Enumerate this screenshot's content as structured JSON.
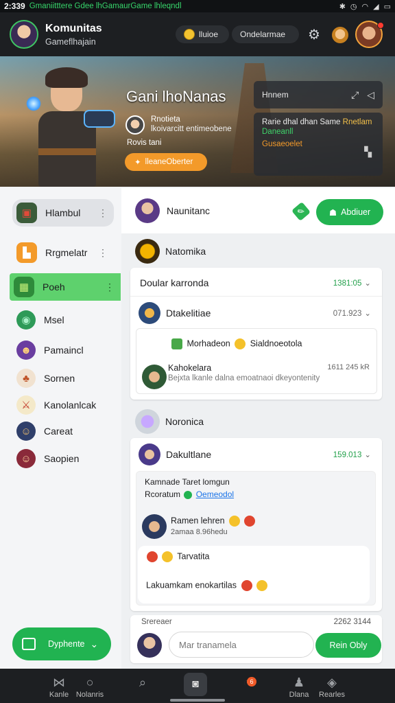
{
  "status_bar": {
    "time": "2:339",
    "ticker": "Gmaniitttere Gdee lhGamaurGame lhleqndl",
    "icons": [
      "bluetooth-icon",
      "alarm-icon",
      "wifi-icon",
      "signal-icon",
      "battery-icon"
    ]
  },
  "header": {
    "title": "Komunitas",
    "subtitle": "Gameflhajain",
    "coins_label": "lluioe",
    "secondary_label": "Ondelarmae"
  },
  "banner": {
    "title": "Gani lhoNanas",
    "author_name": "Rnotieta",
    "author_desc": "lkoivarcitt entimeobene",
    "author_sub": "Rovis tani",
    "cta_label": "lleaneOberter",
    "card1_label": "Hnnem",
    "card2_line1": "Rarie dhal dhan Same",
    "card2_line1_accent": "Rnetlam",
    "card2_line2": "Daneanll",
    "card2_line3": "Gusaeoelet"
  },
  "sidebar": {
    "items": [
      {
        "label": "Hlambul",
        "icon": "game-block-icon",
        "more": "⋮"
      },
      {
        "label": "Rrgmelatr",
        "icon": "orange-box-icon",
        "more": "⋮"
      },
      {
        "label": "Poeh",
        "icon": "green-block-icon",
        "more": "⋮"
      },
      {
        "label": "Msel",
        "icon": "green-orb-icon"
      },
      {
        "label": "Pamaincl",
        "icon": "mage-icon"
      },
      {
        "label": "Sornen",
        "icon": "dual-hero-icon"
      },
      {
        "label": "Kanolanlcak",
        "icon": "sword-icon"
      },
      {
        "label": "Careat",
        "icon": "warrior-icon"
      },
      {
        "label": "Saopien",
        "icon": "rogue-icon"
      }
    ],
    "cta_label": "Dyphente"
  },
  "main": {
    "top_name": "Naunitanc",
    "follow_label": "Abdiuer",
    "group1_title": "Natomika",
    "card1": {
      "row1_title": "Doular karronda",
      "row1_meta": "1381:05",
      "row2_title": "Dtakelitiae",
      "row2_meta": "071.923",
      "reaction_text": "Morhadeon",
      "reaction_text2": "Sialdnoeotola",
      "comment_name": "Kahokelara",
      "comment_time": "1611 245 kR",
      "comment_text": "Bejxta lkanle dalna emoatnaoi dkeyontenity"
    },
    "group2_title": "Noronica",
    "card2": {
      "row1_title": "Dakultlane",
      "row1_meta": "159.013",
      "quote_line1": "Kamnade Taret lomgun",
      "quote_line2": "Rcoratum",
      "quote_link": "Oemeodol",
      "reply_name": "Ramen lehren",
      "reply_sub": "2amaa 8.96hedu",
      "bubble1": "Tarvatita",
      "bubble2": "Lakuamkam enokartilas"
    },
    "composer": {
      "label": "Srereaer",
      "counter": "2262 3144",
      "placeholder": "Mar tranamela",
      "send_label": "Rein Obly"
    }
  },
  "bottom_nav": {
    "items": [
      {
        "label": "Kanle",
        "icon": "controller-icon"
      },
      {
        "label": "Nolanris",
        "icon": "circle-icon"
      },
      {
        "label": "",
        "icon": "search-icon"
      },
      {
        "label": "",
        "icon": "camera-icon"
      },
      {
        "label": "",
        "icon": "chat-icon",
        "badge": "6"
      },
      {
        "label": "Dlana",
        "icon": "person-icon"
      },
      {
        "label": "Rearles",
        "icon": "shield-icon"
      }
    ]
  },
  "colors": {
    "accent": "#22b351",
    "header_bg": "#1d1f22",
    "cta_orange": "#f39a2a"
  }
}
